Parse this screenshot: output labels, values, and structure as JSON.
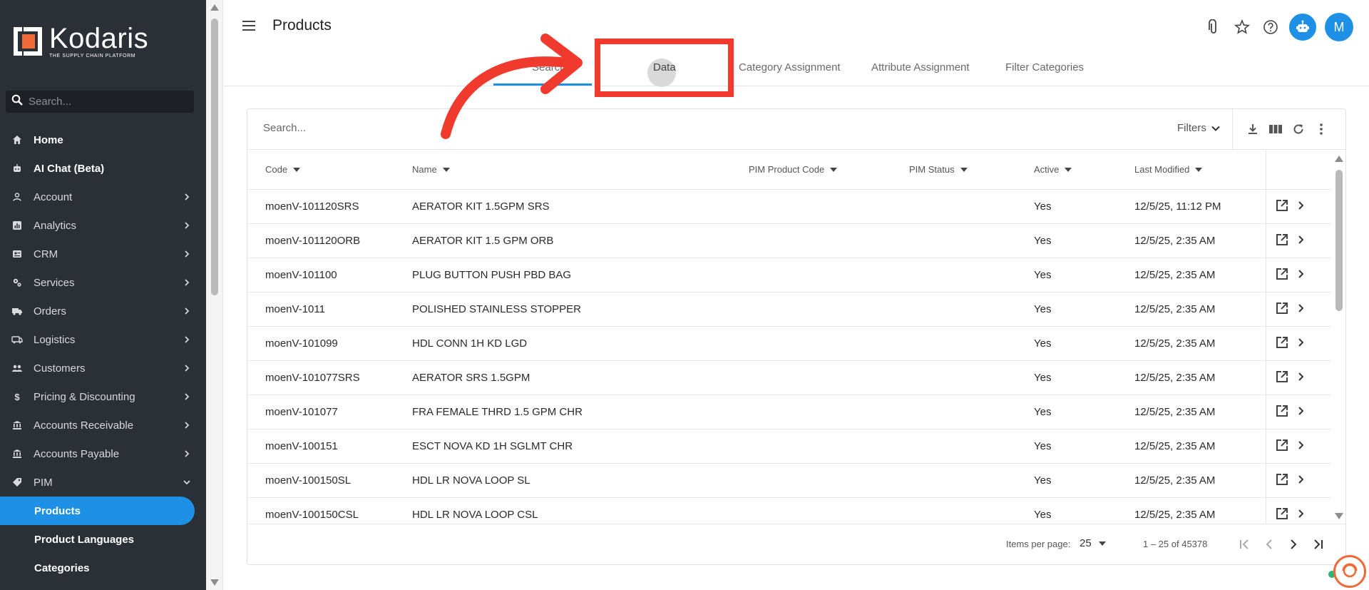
{
  "brand": {
    "name": "Kodaris",
    "tagline": "THE SUPPLY CHAIN PLATFORM",
    "accent": "#1e90e6",
    "sidebar_bg": "#2b2f36",
    "highlight": "#f13a2e"
  },
  "sidebar": {
    "search_placeholder": "Search...",
    "items": [
      {
        "label": "Home",
        "icon": "home-icon",
        "expandable": false
      },
      {
        "label": "AI Chat (Beta)",
        "icon": "robot-icon",
        "expandable": false
      },
      {
        "label": "Account",
        "icon": "person-icon",
        "expandable": true
      },
      {
        "label": "Analytics",
        "icon": "analytics-icon",
        "expandable": true
      },
      {
        "label": "CRM",
        "icon": "contact-card-icon",
        "expandable": true
      },
      {
        "label": "Services",
        "icon": "gears-icon",
        "expandable": true
      },
      {
        "label": "Orders",
        "icon": "truck-icon",
        "expandable": true
      },
      {
        "label": "Logistics",
        "icon": "delivery-van-icon",
        "expandable": true
      },
      {
        "label": "Customers",
        "icon": "people-icon",
        "expandable": true
      },
      {
        "label": "Pricing & Discounting",
        "icon": "dollar-icon",
        "expandable": true
      },
      {
        "label": "Accounts Receivable",
        "icon": "bank-icon",
        "expandable": true
      },
      {
        "label": "Accounts Payable",
        "icon": "bank-icon",
        "expandable": true
      },
      {
        "label": "PIM",
        "icon": "tag-icon",
        "expandable": true,
        "expanded": true
      }
    ],
    "sub_items": [
      {
        "label": "Products",
        "active": true
      },
      {
        "label": "Product Languages",
        "active": false
      },
      {
        "label": "Categories",
        "active": false
      }
    ]
  },
  "header": {
    "title": "Products",
    "avatar_initial": "M"
  },
  "tabs": [
    {
      "label": "Search",
      "active": true
    },
    {
      "label": "Data",
      "active": false
    },
    {
      "label": "Category Assignment",
      "active": false
    },
    {
      "label": "Attribute Assignment",
      "active": false
    },
    {
      "label": "Filter Categories",
      "active": false
    }
  ],
  "table": {
    "search_placeholder": "Search...",
    "filters_label": "Filters",
    "columns": [
      "Code",
      "Name",
      "PIM Product Code",
      "PIM Status",
      "Active",
      "Last Modified"
    ],
    "rows": [
      {
        "code": "moenV-101120SRS",
        "name": "AERATOR KIT 1.5GPM SRS",
        "pim_code": "",
        "pim_status": "",
        "active": "Yes",
        "modified": "12/5/25, 11:12 PM"
      },
      {
        "code": "moenV-101120ORB",
        "name": "AERATOR KIT 1.5 GPM ORB",
        "pim_code": "",
        "pim_status": "",
        "active": "Yes",
        "modified": "12/5/25, 2:35 AM"
      },
      {
        "code": "moenV-101100",
        "name": "PLUG BUTTON PUSH PBD BAG",
        "pim_code": "",
        "pim_status": "",
        "active": "Yes",
        "modified": "12/5/25, 2:35 AM"
      },
      {
        "code": "moenV-1011",
        "name": "POLISHED STAINLESS STOPPER",
        "pim_code": "",
        "pim_status": "",
        "active": "Yes",
        "modified": "12/5/25, 2:35 AM"
      },
      {
        "code": "moenV-101099",
        "name": "HDL CONN 1H KD LGD",
        "pim_code": "",
        "pim_status": "",
        "active": "Yes",
        "modified": "12/5/25, 2:35 AM"
      },
      {
        "code": "moenV-101077SRS",
        "name": "AERATOR SRS 1.5GPM",
        "pim_code": "",
        "pim_status": "",
        "active": "Yes",
        "modified": "12/5/25, 2:35 AM"
      },
      {
        "code": "moenV-101077",
        "name": "FRA FEMALE THRD 1.5 GPM CHR",
        "pim_code": "",
        "pim_status": "",
        "active": "Yes",
        "modified": "12/5/25, 2:35 AM"
      },
      {
        "code": "moenV-100151",
        "name": "ESCT NOVA KD 1H SGLMT CHR",
        "pim_code": "",
        "pim_status": "",
        "active": "Yes",
        "modified": "12/5/25, 2:35 AM"
      },
      {
        "code": "moenV-100150SL",
        "name": "HDL LR NOVA LOOP SL",
        "pim_code": "",
        "pim_status": "",
        "active": "Yes",
        "modified": "12/5/25, 2:35 AM"
      },
      {
        "code": "moenV-100150CSL",
        "name": "HDL LR NOVA LOOP CSL",
        "pim_code": "",
        "pim_status": "",
        "active": "Yes",
        "modified": "12/5/25, 2:35 AM"
      }
    ]
  },
  "paginator": {
    "items_per_page_label": "Items per page:",
    "items_per_page": "25",
    "range": "1 – 25 of 45378"
  }
}
